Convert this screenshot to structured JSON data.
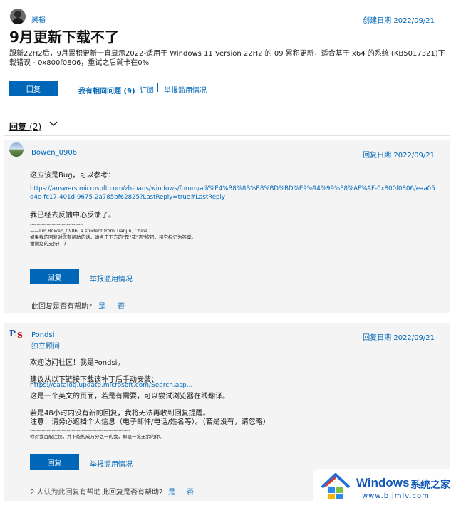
{
  "question": {
    "author": "昊裕",
    "date": "创建日期 2022/09/21",
    "title": "9月更新下载不了",
    "body": "跟新22H2后，9月累积更新一直显示2022-适用于 Windows 11 Version 22H2 的 09 累积更新，适合基于 x64 的系统 (KB5017321)下载错误 - 0x800f0806，重试之后就卡在0%",
    "reply_button": "回复",
    "same_question": "我有相同问题 (9)",
    "subscribe": "订阅",
    "report": "举报滥用情况"
  },
  "replies_header": {
    "label": "回复",
    "count": "(2)"
  },
  "reply1": {
    "author": "Bowen_0906",
    "date": "回复日期 2022/09/21",
    "line1": "这应该是Bug，可以参考：",
    "link": "https://answers.microsoft.com/zh-hans/windows/forum/all/%E4%B8%8B%E8%BD%BD%E9%94%99%E8%AF%AF-0x800f0806/eaa05d4e-fc17-401d-9675-2a785bf62825?LastReply=true#LastReply",
    "line2": "我已经去反馈中心反馈了。",
    "sig_rule": "--------------------------------",
    "sig1": "——I'm Bowen_0906, a student from Tianjin, China.",
    "sig2": "如果我的回复对您有帮助的话，请点击下方的\"是\"或\"否\"按钮，将它标记为答案。",
    "sig3": "谢谢您的支持！:)",
    "reply_button": "回复",
    "report": "举报滥用情况",
    "helpful_q": "此回复是否有帮助?",
    "yes": "是",
    "no": "否"
  },
  "reply2": {
    "author": "Pondsi",
    "role": "独立顾问",
    "date": "回复日期 2022/09/21",
    "line1": "欢迎访问社区！我是Pondsi。",
    "line2": "建议从以下链接下载该补丁后手动安装：",
    "link": "https://catalog.update.microsoft.com/Search.asp...",
    "line3": "这是一个英文的页面，若是有需要，可以尝试浏览器在线翻译。",
    "line4": "若是48小时内没有新的回复，我将无法再收到回复提醒。",
    "line5": "注意！请务必遮挡个人信息（电子邮件/电话/姓名等）。（若是没有，请忽略）",
    "sig_rule": "------------------------------------------------------------",
    "sig1": "你对我百般注视，并不能构成万分之一的我，却是一览无余的你。",
    "reply_button": "回复",
    "report": "举报滥用情况",
    "helpful_count": "2 人认为此回复有帮助",
    "helpful_q": "此回复是否有帮助?",
    "yes": "是",
    "no": "否"
  },
  "watermark": {
    "brand": "Windows",
    "suffix": "系统之家",
    "url": "www.bjjmlv.com"
  },
  "colors": {
    "accent": "#0067b8",
    "card_bg": "#f4f4f4"
  }
}
